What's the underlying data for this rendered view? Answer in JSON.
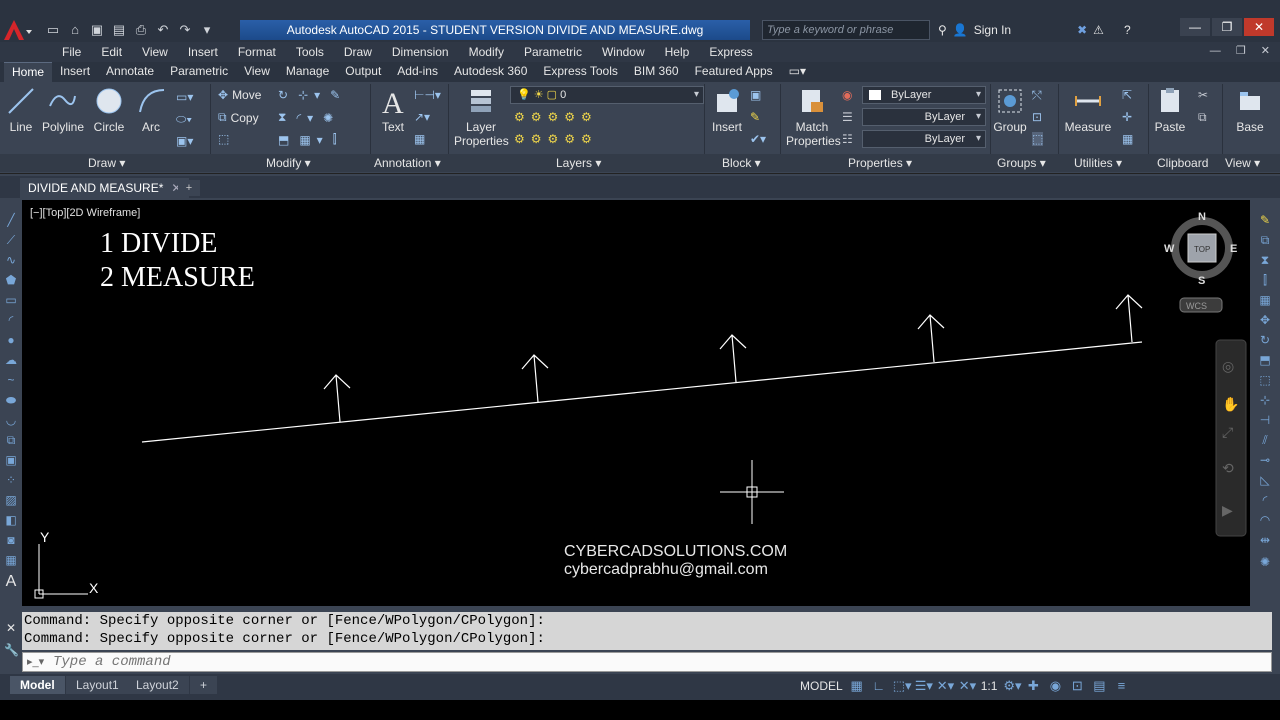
{
  "app": {
    "title": "Autodesk AutoCAD 2015 - STUDENT VERSION    DIVIDE AND MEASURE.dwg",
    "search_placeholder": "Type a keyword or phrase",
    "sign_in": "Sign In"
  },
  "menu": [
    "File",
    "Edit",
    "View",
    "Insert",
    "Format",
    "Tools",
    "Draw",
    "Dimension",
    "Modify",
    "Parametric",
    "Window",
    "Help",
    "Express"
  ],
  "ribbon_tabs": [
    "Home",
    "Insert",
    "Annotate",
    "Parametric",
    "View",
    "Manage",
    "Output",
    "Add-ins",
    "Autodesk 360",
    "Express Tools",
    "BIM 360",
    "Featured Apps"
  ],
  "ribbon": {
    "draw": {
      "line": "Line",
      "polyline": "Polyline",
      "circle": "Circle",
      "arc": "Arc",
      "title": "Draw"
    },
    "modify": {
      "move": "Move",
      "copy": "Copy",
      "title": "Modify"
    },
    "annotation": {
      "text": "Text",
      "title": "Annotation"
    },
    "layers": {
      "layer_properties_1": "Layer",
      "layer_properties_2": "Properties",
      "current_layer": "0",
      "title": "Layers"
    },
    "block": {
      "insert": "Insert",
      "title": "Block"
    },
    "properties": {
      "match_1": "Match",
      "match_2": "Properties",
      "color": "ByLayer",
      "linetype": "ByLayer",
      "lineweight": "ByLayer",
      "title": "Properties"
    },
    "groups": {
      "group": "Group",
      "title": "Groups"
    },
    "utilities": {
      "measure": "Measure",
      "title": "Utilities"
    },
    "clipboard": {
      "paste": "Paste",
      "title": "Clipboard"
    },
    "view": {
      "base": "Base",
      "title": "View"
    }
  },
  "document_tab": "DIVIDE AND MEASURE*",
  "canvas": {
    "view_label": "[−][Top][2D Wireframe]",
    "text_line1": "1 DIVIDE",
    "text_line2": "2 MEASURE",
    "watermark1": "CYBERCADSOLUTIONS.COM",
    "watermark2": "cybercadprabhu@gmail.com",
    "viewcube": {
      "n": "N",
      "s": "S",
      "e": "E",
      "w": "W",
      "top": "TOP",
      "wcs": "WCS"
    },
    "ucs": {
      "x": "X",
      "y": "Y"
    }
  },
  "command": {
    "history": [
      "Command: Specify opposite corner or [Fence/WPolygon/CPolygon]:",
      "Command: Specify opposite corner or [Fence/WPolygon/CPolygon]:"
    ],
    "placeholder": "Type a command"
  },
  "layout_tabs": [
    "Model",
    "Layout1",
    "Layout2"
  ],
  "status": {
    "model": "MODEL",
    "scale": "1:1"
  }
}
